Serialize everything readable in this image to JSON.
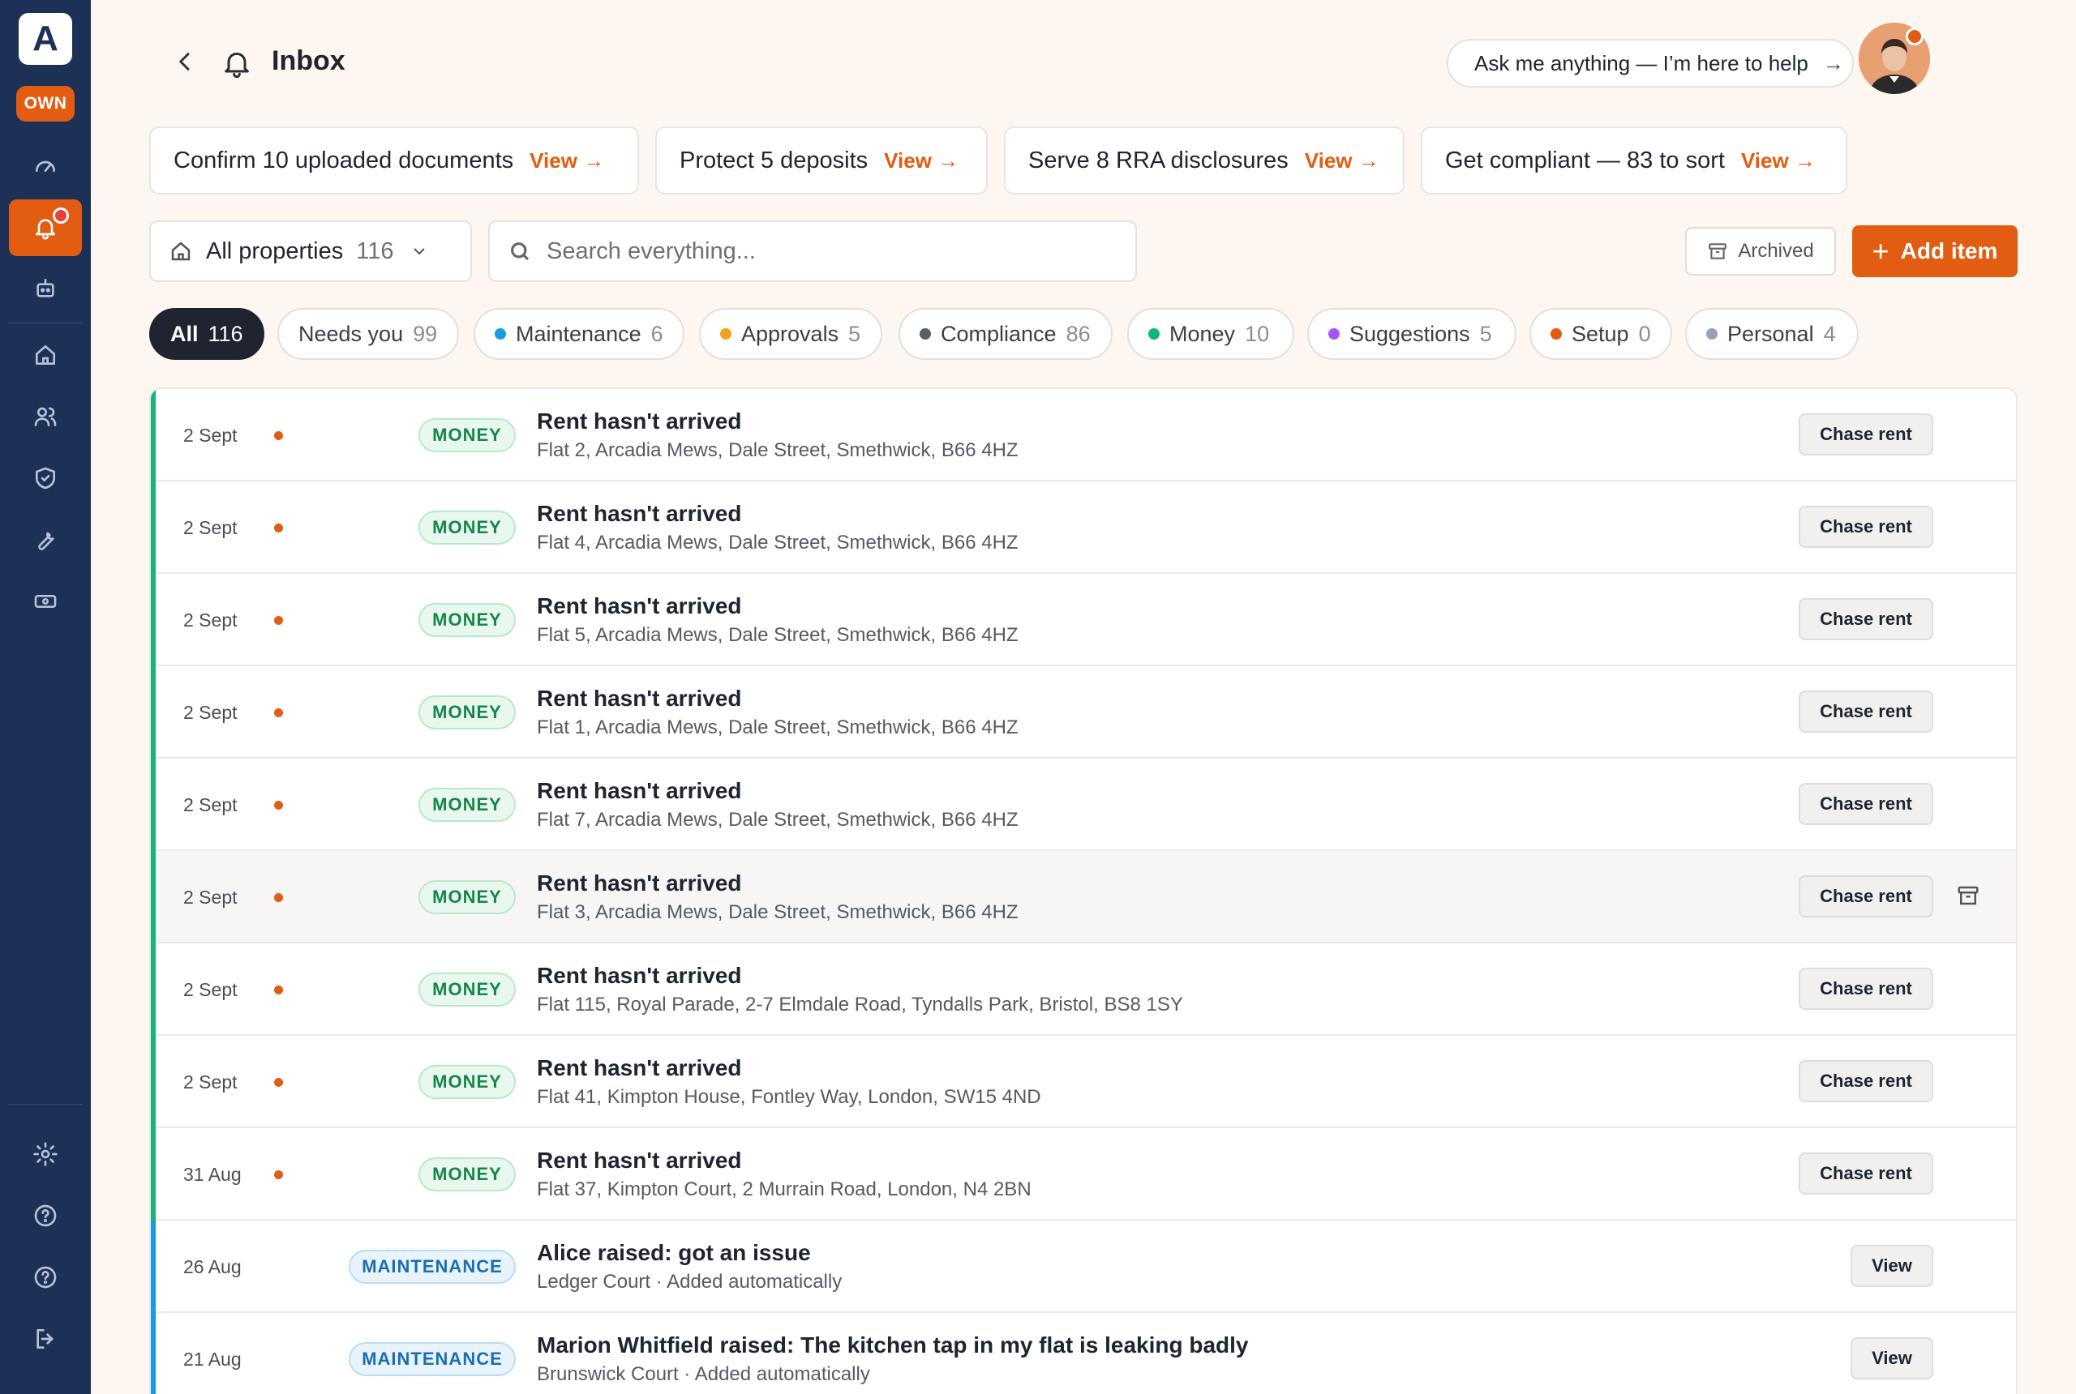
{
  "brand": {
    "logo_letter": "A",
    "badge": "OWN",
    "accent": "#e25c12",
    "sidebar_bg": "#1d3157"
  },
  "sidebar": {
    "items": [
      {
        "icon": "gauge-icon",
        "active": false
      },
      {
        "icon": "bell-icon",
        "active": true,
        "badge": true
      },
      {
        "icon": "robot-icon",
        "active": false
      },
      {
        "icon": "home-icon",
        "active": false
      },
      {
        "icon": "users-icon",
        "active": false
      },
      {
        "icon": "shield-icon",
        "active": false
      },
      {
        "icon": "wrench-icon",
        "active": false
      },
      {
        "icon": "cash-icon",
        "active": false
      }
    ],
    "bottom": [
      {
        "icon": "gear-icon"
      },
      {
        "icon": "help-icon"
      },
      {
        "icon": "help-icon"
      },
      {
        "icon": "logout-icon"
      }
    ]
  },
  "header": {
    "title": "Inbox",
    "ask_label": "Ask me anything — I’m here to help",
    "ask_arrow": "→"
  },
  "tasks": [
    {
      "label": "Confirm 10 uploaded documents",
      "action": "View →"
    },
    {
      "label": "Protect 5 deposits",
      "action": "View →"
    },
    {
      "label": "Serve 8 RRA disclosures",
      "action": "View →"
    },
    {
      "label": "Get compliant — 83 to sort",
      "action": "View →"
    }
  ],
  "filters": {
    "property_label": "All properties",
    "property_count": "116",
    "search_placeholder": "Search everything...",
    "archived_label": "Archived",
    "add_label": "Add item",
    "add_icon": "+"
  },
  "chips": [
    {
      "label": "All",
      "count": "116",
      "active": true
    },
    {
      "label": "Needs you",
      "count": "99"
    },
    {
      "label": "Maintenance",
      "count": "6",
      "color": "#1a9be0"
    },
    {
      "label": "Approvals",
      "count": "5",
      "color": "#f5a020"
    },
    {
      "label": "Compliance",
      "count": "86",
      "color": "#5a5e66"
    },
    {
      "label": "Money",
      "count": "10",
      "color": "#16b57a"
    },
    {
      "label": "Suggestions",
      "count": "5",
      "color": "#a855f7"
    },
    {
      "label": "Setup",
      "count": "0",
      "color": "#e25c12"
    },
    {
      "label": "Personal",
      "count": "4",
      "color": "#94a3b8"
    }
  ],
  "rows": [
    {
      "date": "2 Sept",
      "tag": "MONEY",
      "title": "Rent hasn't arrived",
      "sub": "Flat 2, Arcadia Mews, Dale Street, Smethwick, B66 4HZ",
      "action": "Chase rent"
    },
    {
      "date": "2 Sept",
      "tag": "MONEY",
      "title": "Rent hasn't arrived",
      "sub": "Flat 4, Arcadia Mews, Dale Street, Smethwick, B66 4HZ",
      "action": "Chase rent"
    },
    {
      "date": "2 Sept",
      "tag": "MONEY",
      "title": "Rent hasn't arrived",
      "sub": "Flat 5, Arcadia Mews, Dale Street, Smethwick, B66 4HZ",
      "action": "Chase rent"
    },
    {
      "date": "2 Sept",
      "tag": "MONEY",
      "title": "Rent hasn't arrived",
      "sub": "Flat 1, Arcadia Mews, Dale Street, Smethwick, B66 4HZ",
      "action": "Chase rent"
    },
    {
      "date": "2 Sept",
      "tag": "MONEY",
      "title": "Rent hasn't arrived",
      "sub": "Flat 7, Arcadia Mews, Dale Street, Smethwick, B66 4HZ",
      "action": "Chase rent"
    },
    {
      "date": "2 Sept",
      "tag": "MONEY",
      "title": "Rent hasn't arrived",
      "sub": "Flat 3, Arcadia Mews, Dale Street, Smethwick, B66 4HZ",
      "action": "Chase rent"
    },
    {
      "date": "2 Sept",
      "tag": "MONEY",
      "title": "Rent hasn't arrived",
      "sub": "Flat 115, Royal Parade, 2-7 Elmdale Road, Tyndalls Park, Bristol, BS8 1SY",
      "action": "Chase rent"
    },
    {
      "date": "2 Sept",
      "tag": "MONEY",
      "title": "Rent hasn't arrived",
      "sub": "Flat 41, Kimpton House, Fontley Way, London, SW15 4ND",
      "action": "Chase rent"
    },
    {
      "date": "31 Aug",
      "tag": "MONEY",
      "title": "Rent hasn't arrived",
      "sub": "Flat 37, Kimpton Court, 2 Murrain Road, London, N4 2BN",
      "action": "Chase rent"
    },
    {
      "date": "26 Aug",
      "tag": "MAINTENANCE",
      "title": "Alice raised: got an issue",
      "sub": "Ledger Court · Added automatically",
      "action": "View"
    },
    {
      "date": "21 Aug",
      "tag": "MAINTENANCE",
      "title": "Marion Whitfield raised: The kitchen tap in my flat is leaking badly",
      "sub": "Brunswick Court · Added automatically",
      "action": "View"
    }
  ]
}
